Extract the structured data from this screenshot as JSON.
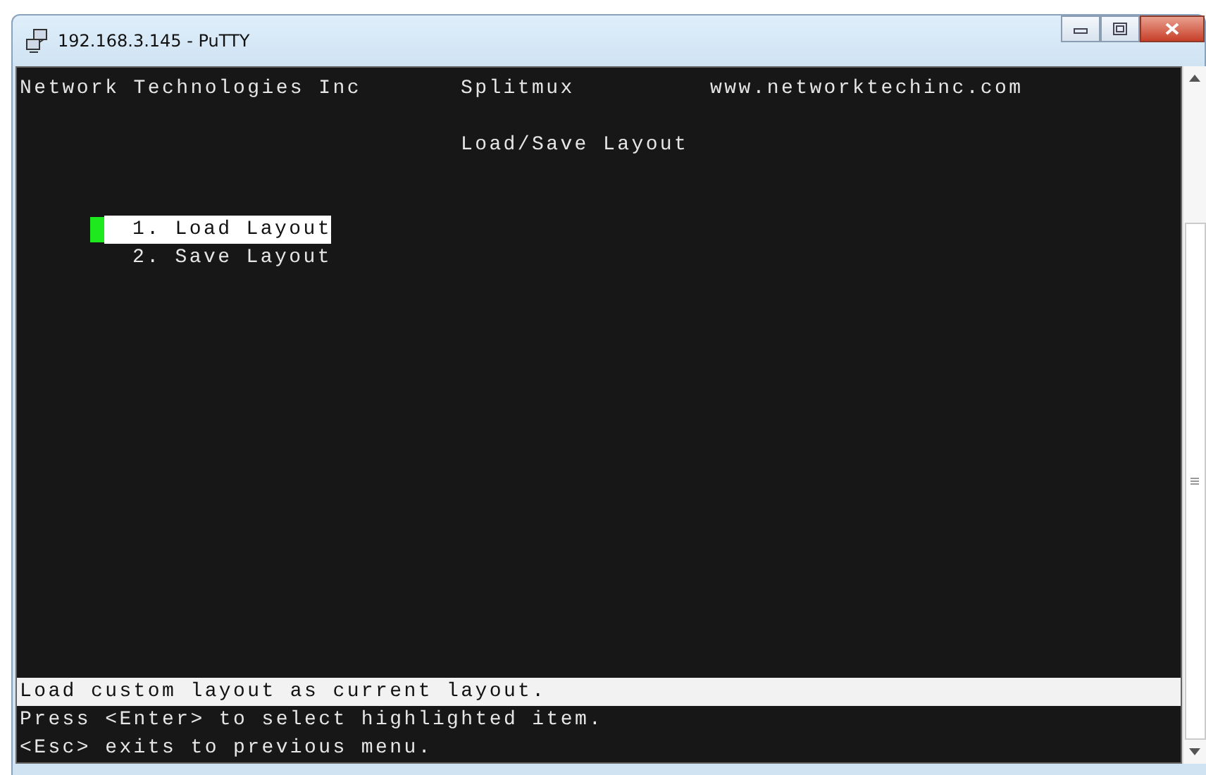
{
  "window": {
    "title": "192.168.3.145 - PuTTY"
  },
  "header": {
    "company": "Network Technologies Inc",
    "product": "Splitmux",
    "website": "www.networktechinc.com"
  },
  "screen_title": "Load/Save Layout",
  "menu": [
    {
      "label": "1. Load Layout",
      "selected": true
    },
    {
      "label": "2. Save Layout",
      "selected": false
    }
  ],
  "help_lines": [
    {
      "text": "Load custom layout as current layout.",
      "kind": "description"
    },
    {
      "text": "Press <Enter> to select highlighted item.",
      "kind": "hint"
    },
    {
      "text": "<Esc> exits to previous menu.",
      "kind": "hint"
    }
  ]
}
